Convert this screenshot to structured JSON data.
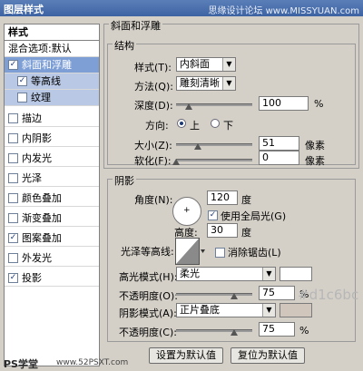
{
  "window": {
    "title": "图层样式",
    "watermark": "思缘设计论坛 www.MISSYUAN.com"
  },
  "sidebar": {
    "header": "样式",
    "blend_options": "混合选项:默认",
    "items": [
      {
        "label": "斜面和浮雕",
        "checked": true
      },
      {
        "label": "等高线",
        "checked": true
      },
      {
        "label": "纹理",
        "checked": false
      },
      {
        "label": "描边",
        "checked": false
      },
      {
        "label": "内阴影",
        "checked": false
      },
      {
        "label": "内发光",
        "checked": false
      },
      {
        "label": "光泽",
        "checked": false
      },
      {
        "label": "颜色叠加",
        "checked": false
      },
      {
        "label": "渐变叠加",
        "checked": false
      },
      {
        "label": "图案叠加",
        "checked": true
      },
      {
        "label": "外发光",
        "checked": false
      },
      {
        "label": "投影",
        "checked": true
      }
    ]
  },
  "bevel": {
    "section_title": "斜面和浮雕",
    "structure_title": "结构",
    "style_label": "样式(T):",
    "style_value": "内斜面",
    "technique_label": "方法(Q):",
    "technique_value": "雕刻清晰",
    "depth_label": "深度(D):",
    "depth_value": "100",
    "depth_unit": "%",
    "direction_label": "方向:",
    "dir_up": "上",
    "dir_down": "下",
    "size_label": "大小(Z):",
    "size_value": "51",
    "size_unit": "像素",
    "soften_label": "软化(F):",
    "soften_value": "0",
    "soften_unit": "像素"
  },
  "shading": {
    "title": "阴影",
    "angle_label": "角度(N):",
    "angle_value": "120",
    "angle_unit": "度",
    "global_light_label": "使用全局光(G)",
    "altitude_label": "高度:",
    "altitude_value": "30",
    "altitude_unit": "度",
    "gloss_label": "光泽等高线:",
    "antialias_label": "消除锯齿(L)",
    "highlight_label": "高光模式(H):",
    "highlight_value": "柔光",
    "highlight_opacity_label": "不透明度(O):",
    "highlight_opacity_value": "75",
    "shadow_label": "阴影模式(A):",
    "shadow_value": "正片叠底",
    "shadow_opacity_label": "不透明度(C):",
    "shadow_opacity_value": "75",
    "percent": "%",
    "color_annotation": "#d1c6bc",
    "highlight_color": "#ffffff",
    "shadow_color": "#d1c6bc"
  },
  "buttons": {
    "set_default": "设置为默认值",
    "reset_default": "复位为默认值"
  },
  "footer": {
    "logo": "PS学堂",
    "site": "www.52PSXT.com"
  }
}
